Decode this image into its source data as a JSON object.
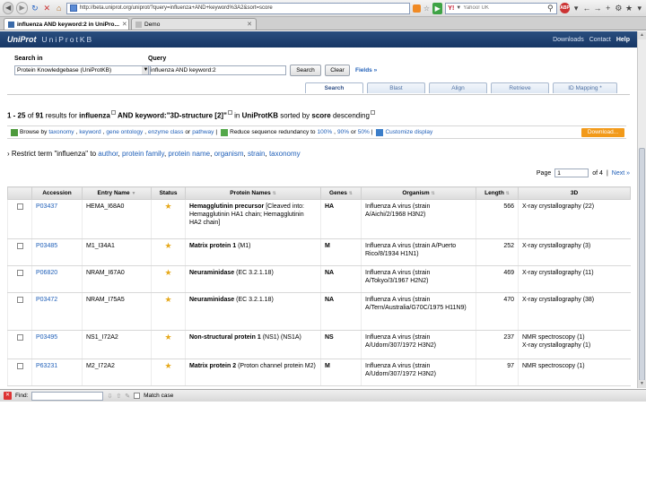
{
  "browser": {
    "url": "http://beta.uniprot.org/uniprot/?query=influenza+AND+keyword%3A2&sort=score",
    "search_engine_placeholder": "Yahoo! UK",
    "search_engine_name": "Y!",
    "tabs": [
      {
        "label": "influenza AND keyword:2 in UniPro..."
      },
      {
        "label": "Demo"
      }
    ]
  },
  "header": {
    "logo": "UniProt",
    "subtitle": "UniProtKB",
    "links": [
      "Downloads",
      "Contact",
      "Help"
    ]
  },
  "search": {
    "search_in_label": "Search in",
    "database": "Protein Knowledgebase (UniProtKB)",
    "query_label": "Query",
    "query_value": "influenza AND keyword:2",
    "search_btn": "Search",
    "clear_btn": "Clear",
    "fields_link": "Fields »"
  },
  "subtabs": [
    "Search",
    "Blast",
    "Align",
    "Retrieve",
    "ID Mapping *"
  ],
  "results": {
    "range": "1 - 25",
    "of_text": "of",
    "total": "91",
    "results_for": "results for",
    "term1": "influenza",
    "and_kw": "AND keyword:",
    "term2": "\"3D-structure [2]\"",
    "in_text": "in",
    "db": "UniProtKB",
    "sorted_by": "sorted by",
    "sort": "score",
    "order": "descending"
  },
  "browse": {
    "prefix": "Browse by",
    "links": [
      "taxonomy",
      "keyword",
      "gene ontology",
      "enzyme class",
      "pathway"
    ],
    "sep_comma": ",",
    "sep_or": "or",
    "sep_bar": "|",
    "reduce_text": "Reduce sequence redundancy to",
    "redundancy": [
      "100%",
      "90%",
      "50%"
    ],
    "customize": "Customize display",
    "download": "Download..."
  },
  "restrict": {
    "prefix": "› Restrict term \"influenza\" to",
    "links": [
      "author",
      "protein family",
      "protein name",
      "organism",
      "strain",
      "taxonomy"
    ]
  },
  "pager": {
    "label": "Page",
    "value": "1",
    "of": "of 4",
    "next": "Next »"
  },
  "table": {
    "columns": [
      "",
      "Accession",
      "Entry Name",
      "Status",
      "Protein Names",
      "Genes",
      "Organism",
      "Length",
      "3D"
    ],
    "rows": [
      {
        "accession": "P03437",
        "entry": "HEMA_I68A0",
        "protein_bold": "Hemagglutinin precursor",
        "protein_rest": "[Cleaved into: Hemagglutinin HA1 chain; Hemagglutinin HA2 chain]",
        "genes": "HA",
        "organism": "Influenza A virus (strain A/Aichi/2/1968 H3N2)",
        "length": "566",
        "struct": "X-ray crystallography (22)"
      },
      {
        "accession": "P03485",
        "entry": "M1_I34A1",
        "protein_bold": "Matrix protein 1",
        "protein_rest": "(M1)",
        "genes": "M",
        "organism": "Influenza A virus (strain A/Puerto Rico/8/1934 H1N1)",
        "length": "252",
        "struct": "X-ray crystallography (3)"
      },
      {
        "accession": "P06820",
        "entry": "NRAM_I67A0",
        "protein_bold": "Neuraminidase",
        "protein_rest": "(EC 3.2.1.18)",
        "genes": "NA",
        "organism": "Influenza A virus (strain A/Tokyo/3/1967 H2N2)",
        "length": "469",
        "struct": "X-ray crystallography (11)"
      },
      {
        "accession": "P03472",
        "entry": "NRAM_I75A5",
        "protein_bold": "Neuraminidase",
        "protein_rest": "(EC 3.2.1.18)",
        "genes": "NA",
        "organism": "Influenza A virus (strain A/Tern/Australia/G70C/1975 H11N9)",
        "length": "470",
        "struct": "X-ray crystallography (38)"
      },
      {
        "accession": "P03495",
        "entry": "NS1_I72A2",
        "protein_bold": "Non-structural protein 1",
        "protein_rest": "(NS1) (NS1A)",
        "genes": "NS",
        "organism": "Influenza A virus (strain A/Udorn/307/1972 H3N2)",
        "length": "237",
        "struct": "NMR spectroscopy (1)\nX-ray crystallography (1)"
      },
      {
        "accession": "P63231",
        "entry": "M2_I72A2",
        "protein_bold": "Matrix protein 2",
        "protein_rest": "(Proton channel protein M2)",
        "genes": "M",
        "organism": "Influenza A virus (strain A/Udorn/307/1972 H3N2)",
        "length": "97",
        "struct": "NMR spectroscopy (1)"
      }
    ]
  },
  "findbar": {
    "label": "Find:",
    "match_case": "Match case"
  }
}
